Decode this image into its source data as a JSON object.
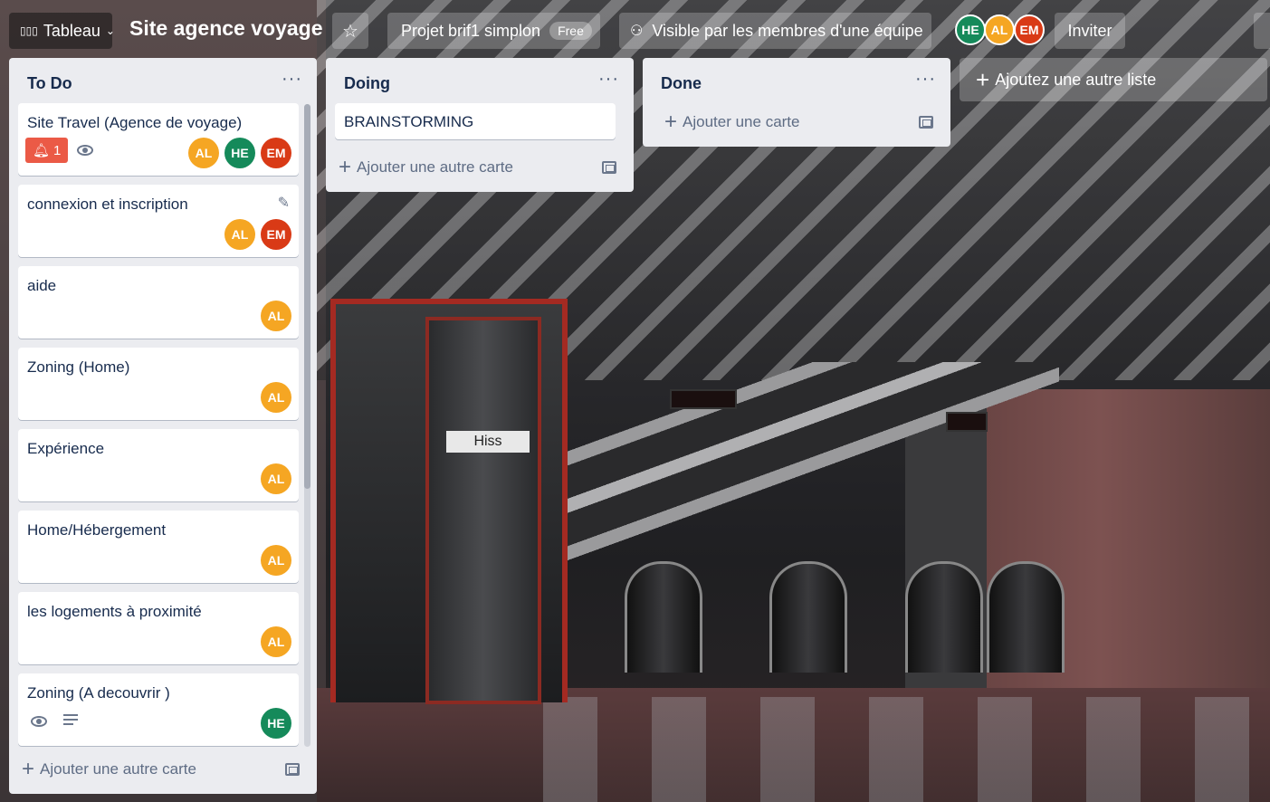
{
  "header": {
    "board_switcher": "Tableau",
    "board_title": "Site agence voyage",
    "workspace": "Projet brif1 simplon",
    "workspace_plan": "Free",
    "visibility": "Visible par les membres d'une équipe",
    "members": [
      "HE",
      "AL",
      "EM"
    ],
    "invite_label": "Inviter"
  },
  "lists": [
    {
      "title": "To Do",
      "cards": [
        {
          "title": "Site Travel (Agence de voyage)",
          "badge_count": "1",
          "members": [
            "AL",
            "HE",
            "EM"
          ]
        },
        {
          "title": "connexion et inscription",
          "members": [
            "AL",
            "EM"
          ]
        },
        {
          "title": "aide",
          "members": [
            "AL"
          ]
        },
        {
          "title": "Zoning (Home)",
          "members": [
            "AL"
          ]
        },
        {
          "title": "Expérience",
          "members": [
            "AL"
          ]
        },
        {
          "title": "Home/Hébergement",
          "members": [
            "AL"
          ]
        },
        {
          "title": "les logements à proximité",
          "members": [
            "AL"
          ]
        },
        {
          "title": "Zoning (A decouvrir )",
          "members": [
            "HE"
          ]
        }
      ],
      "add_card": "Ajouter une autre carte"
    },
    {
      "title": "Doing",
      "cards": [
        {
          "title": "BRAINSTORMING"
        }
      ],
      "add_card": "Ajouter une autre carte"
    },
    {
      "title": "Done",
      "cards": [],
      "add_card": "Ajouter une carte"
    }
  ],
  "add_list": "Ajoutez une autre liste",
  "background_sign": "Hiss",
  "colors": {
    "AL": "#f5a623",
    "HE": "#158a5a",
    "EM": "#d93a16",
    "badge_red": "#eb5a46",
    "list_bg": "#ebecf0"
  }
}
